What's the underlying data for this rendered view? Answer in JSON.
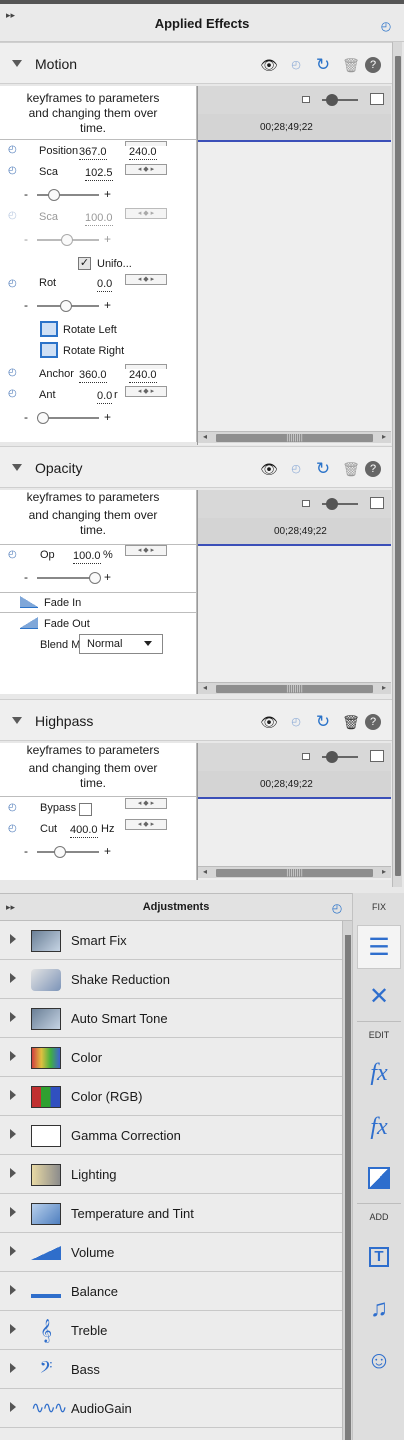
{
  "header": {
    "title": "Applied Effects"
  },
  "icons": {
    "pin": "pin-icon",
    "eye": "eye-icon",
    "reset": "reset-icon",
    "trash": "trash-icon",
    "help": "help-icon"
  },
  "common": {
    "desc_lines": [
      "keyframes to parameters",
      "and changing them over",
      "time."
    ]
  },
  "motion": {
    "name": "Motion",
    "timecode": "00;28;49;22",
    "position": {
      "label": "Position",
      "x": "367.0",
      "y": "240.0"
    },
    "scale": {
      "label": "Sca",
      "value": "102.5"
    },
    "scale_w": {
      "label": "Sca",
      "value": "100.0"
    },
    "uniform": {
      "label": "Unifo..."
    },
    "rotation": {
      "label": "Rot",
      "value": "0.0"
    },
    "rotate_left": "Rotate Left",
    "rotate_right": "Rotate Right",
    "anchor": {
      "label": "Anchor",
      "x": "360.0",
      "y": "240.0"
    },
    "anti": {
      "label": "Ant",
      "value": "0.0",
      "unit": "r"
    },
    "minus": "-",
    "plus": "+"
  },
  "opacity": {
    "name": "Opacity",
    "timecode": "00;28;49;22",
    "op": {
      "label": "Op",
      "value": "100.0",
      "unit": "%"
    },
    "fade_in": "Fade In",
    "fade_out": "Fade Out",
    "blend": {
      "label": "Blend M",
      "value": "Normal"
    }
  },
  "highpass": {
    "name": "Highpass",
    "timecode": "00;28;49;22",
    "bypass": {
      "label": "Bypass"
    },
    "cut": {
      "label": "Cut",
      "value": "400.0",
      "unit": "Hz"
    }
  },
  "adjustments": {
    "title": "Adjustments",
    "items": [
      {
        "label": "Smart Fix"
      },
      {
        "label": "Shake Reduction"
      },
      {
        "label": "Auto Smart Tone"
      },
      {
        "label": "Color"
      },
      {
        "label": "Color (RGB)"
      },
      {
        "label": "Gamma Correction"
      },
      {
        "label": "Lighting"
      },
      {
        "label": "Temperature and Tint"
      },
      {
        "label": "Volume"
      },
      {
        "label": "Balance"
      },
      {
        "label": "Treble"
      },
      {
        "label": "Bass"
      },
      {
        "label": "AudioGain"
      }
    ]
  },
  "sidebar": {
    "fix": "FIX",
    "edit": "EDIT",
    "add": "ADD",
    "fx": "fx"
  }
}
